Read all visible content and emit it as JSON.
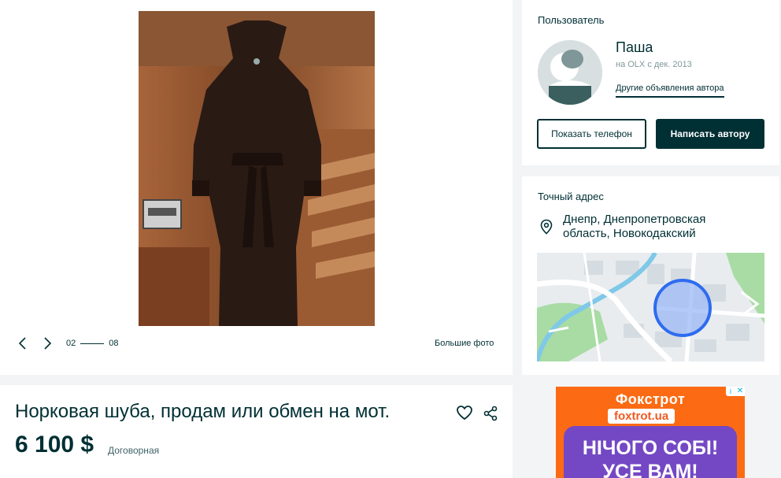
{
  "gallery": {
    "counter_current": "02",
    "counter_total": "08",
    "bigger_photos_label": "Большие фото"
  },
  "user": {
    "section_title": "Пользователь",
    "name": "Паша",
    "since": "на OLX с дек. 2013",
    "other_ads_label": "Другие объявления автора",
    "show_phone_label": "Показать телефон",
    "message_author_label": "Написать автору"
  },
  "address": {
    "section_title": "Точный адрес",
    "text": "Днепр, Днепропетровская область, Новокодакский"
  },
  "listing": {
    "title": "Норковая шуба, продам или обмен на мот.",
    "price": "6 100 $",
    "negotiable": "Договорная"
  },
  "banner": {
    "brand": "Фокстрот",
    "site": "foxtrot.ua",
    "line1": "НІЧОГО СОБІ!",
    "line2": "УСЕ ВАМ!"
  },
  "colors": {
    "text_primary": "#002f34",
    "button_dark": "#002f34",
    "map_circle": "#2e6bf0",
    "banner_orange": "#fc6b14",
    "banner_purple": "#7448c4"
  }
}
